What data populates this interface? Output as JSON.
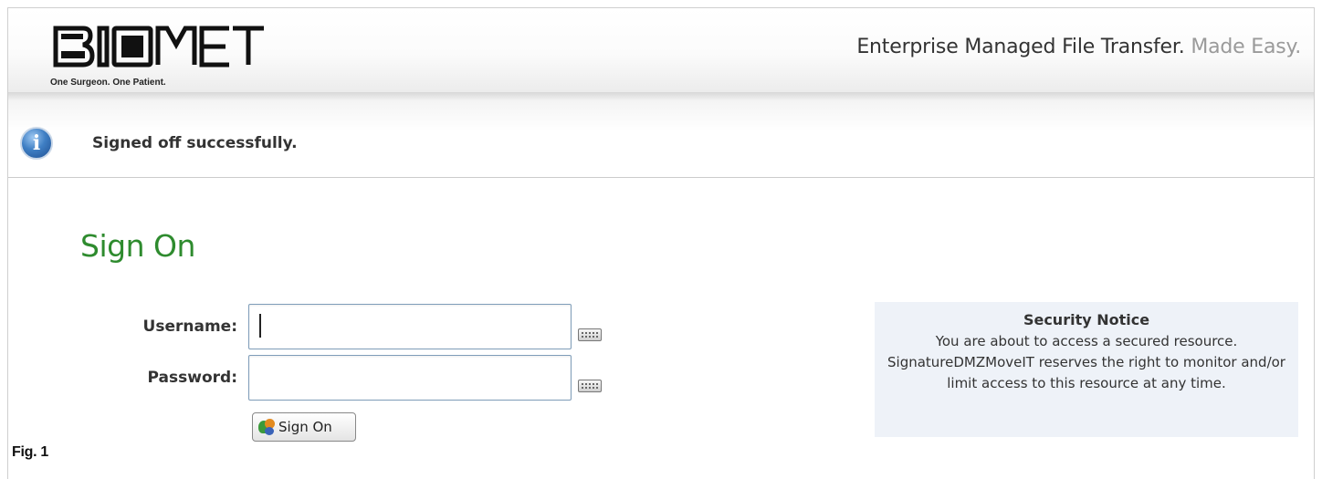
{
  "header": {
    "brand": "BIOMET",
    "tagline": "One Surgeon. One Patient.",
    "slogan_main": "Enterprise Managed File Transfer.",
    "slogan_muted": "Made Easy."
  },
  "message": {
    "icon": "info-icon",
    "text": "Signed off successfully."
  },
  "signon": {
    "title": "Sign On",
    "username_label": "Username:",
    "username_value": "",
    "password_label": "Password:",
    "password_value": "",
    "keyboard_icon": "keyboard-icon",
    "button_label": "Sign On",
    "button_icon": "signon-icon"
  },
  "security_notice": {
    "title": "Security Notice",
    "body": "You are about to access a secured resource. SignatureDMZMoveIT reserves the right to monitor and/or limit access to this resource at any time."
  },
  "figure": {
    "label": "Fig. 1"
  },
  "colors": {
    "title_green": "#2e8b2e",
    "notice_bg": "#eef2f8",
    "info_blue": "#3f7fc4"
  }
}
